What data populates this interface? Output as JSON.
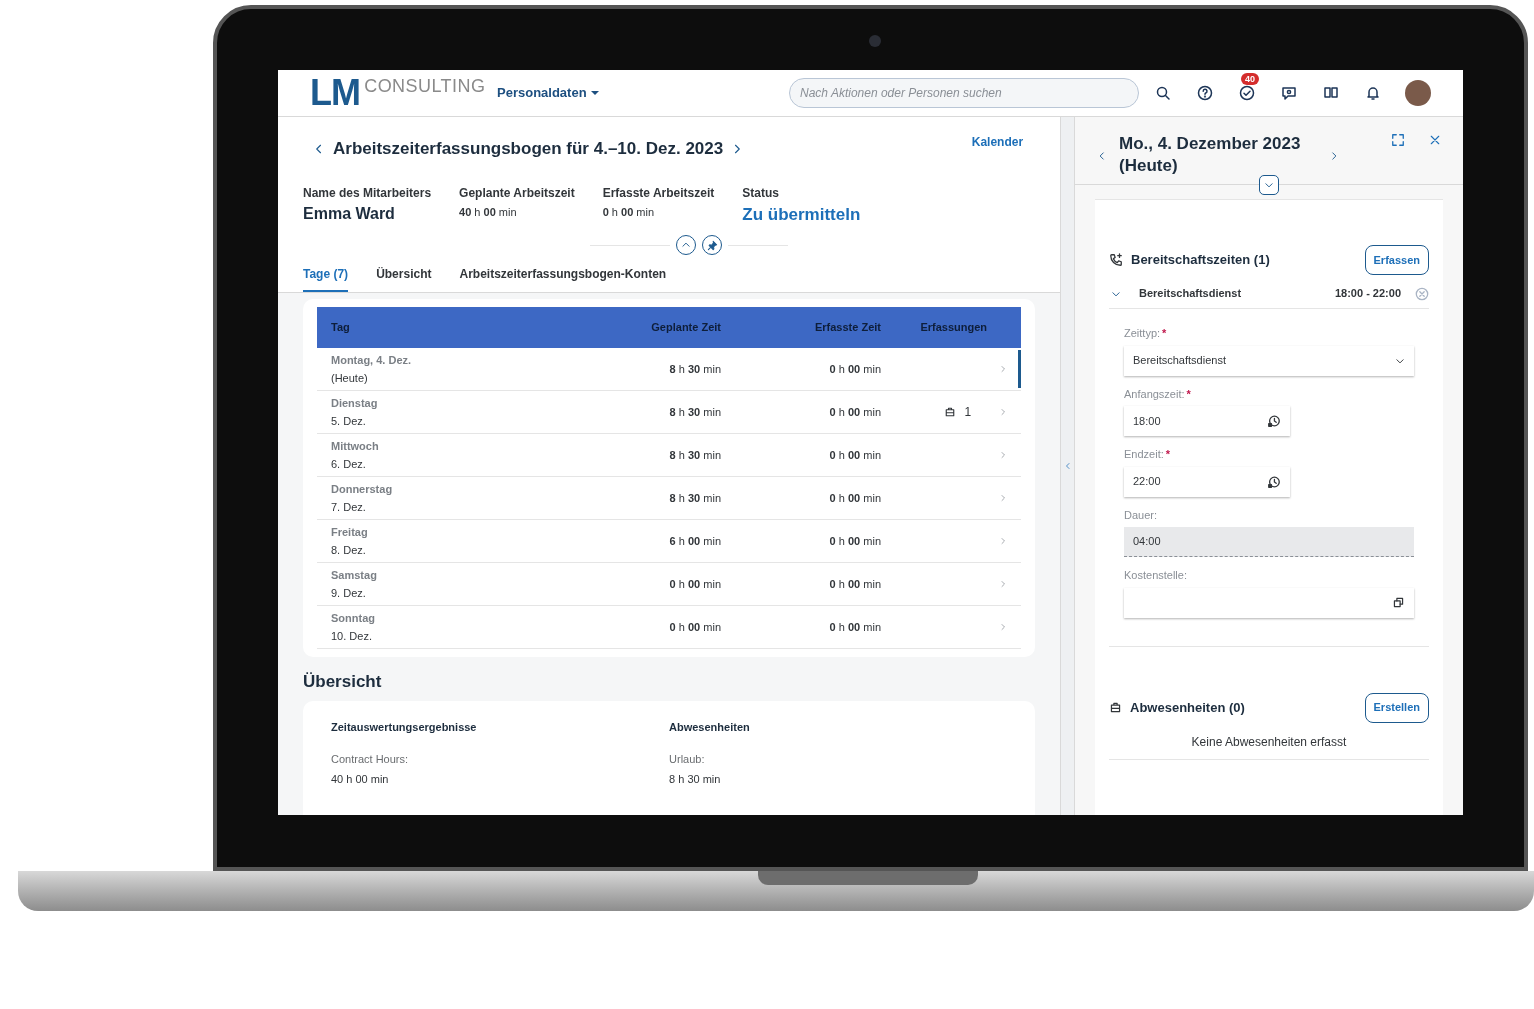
{
  "header": {
    "logo_main": "LM",
    "logo_sub": "CONSULTING",
    "menu": "Personaldaten",
    "search": {
      "placeholder": "Nach Aktionen oder Personen suchen"
    },
    "task_badge": "40"
  },
  "sheet": {
    "title": "Arbeitszeiterfassungsbogen für 4.–10. Dez. 2023",
    "calendar_link": "Kalender",
    "attributes": [
      {
        "label": "Name des Mitarbeiters",
        "value": "Emma Ward",
        "kind": "name"
      },
      {
        "label": "Geplante Arbeitszeit",
        "value": "**40** h **00** min",
        "kind": "time"
      },
      {
        "label": "Erfasste Arbeitszeit",
        "value": "**0** h **00** min",
        "kind": "time"
      },
      {
        "label": "Status",
        "value": "Zu übermitteln",
        "kind": "status"
      }
    ],
    "tabs": [
      {
        "label": "Tage (7)",
        "selected": true
      },
      {
        "label": "Übersicht",
        "selected": false
      },
      {
        "label": "Arbeitszeiterfassungsbogen-Konten",
        "selected": false
      }
    ],
    "table": {
      "columns": [
        "Tag",
        "Geplante Zeit",
        "Erfasste Zeit",
        "Erfassungen"
      ],
      "rows": [
        {
          "day": "Montag, 4. Dez.",
          "date": "(Heute)",
          "planned": "**8** h **30** min",
          "recorded": "**0** h **00** min",
          "selected": true
        },
        {
          "day": "Dienstag",
          "date": "5. Dez.",
          "planned": "**8** h **30** min",
          "recorded": "**0** h **00** min",
          "entries": "1",
          "selected": false
        },
        {
          "day": "Mittwoch",
          "date": "6. Dez.",
          "planned": "**8** h **30** min",
          "recorded": "**0** h **00** min",
          "selected": false
        },
        {
          "day": "Donnerstag",
          "date": "7. Dez.",
          "planned": "**8** h **30** min",
          "recorded": "**0** h **00** min",
          "selected": false
        },
        {
          "day": "Freitag",
          "date": "8. Dez.",
          "planned": "**6** h **00** min",
          "recorded": "**0** h **00** min",
          "selected": false
        },
        {
          "day": "Samstag",
          "date": "9. Dez.",
          "planned": "**0** h **00** min",
          "recorded": "**0** h **00** min",
          "selected": false
        },
        {
          "day": "Sonntag",
          "date": "10. Dez.",
          "planned": "**0** h **00** min",
          "recorded": "**0** h **00** min",
          "selected": false
        }
      ]
    },
    "overview": {
      "title": "Übersicht",
      "groups": [
        {
          "title": "Zeitauswertungsergebnisse",
          "label": "Contract Hours:",
          "value": "40 h 00 min"
        },
        {
          "title": "Abwesenheiten",
          "label": "Urlaub:",
          "value": "8 h 30 min"
        }
      ]
    }
  },
  "detail": {
    "title": "Mo., 4. Dezember 2023 (Heute)",
    "standby": {
      "title": "Bereitschaftszeiten (1)",
      "button": "Erfassen",
      "entry": {
        "name": "Bereitschaftsdienst",
        "time": "18:00 - 22:00",
        "expanded": true
      },
      "fields": [
        {
          "label": "Zeittyp:",
          "required_mark": "*",
          "value": "Bereitschaftsdienst",
          "kind": "select"
        },
        {
          "label": "Anfangszeit:",
          "required_mark": "*",
          "value": "18:00",
          "kind": "time"
        },
        {
          "label": "Endzeit:",
          "required_mark": "*",
          "value": "22:00",
          "kind": "time"
        },
        {
          "label": "Dauer:",
          "value": "04:00",
          "kind": "readonly"
        },
        {
          "label": "Kostenstelle:",
          "kind": "valuehelp"
        }
      ]
    },
    "absences": {
      "title": "Abwesenheiten (0)",
      "button": "Erstellen",
      "empty": "Keine Abwesenheiten erfasst"
    }
  }
}
